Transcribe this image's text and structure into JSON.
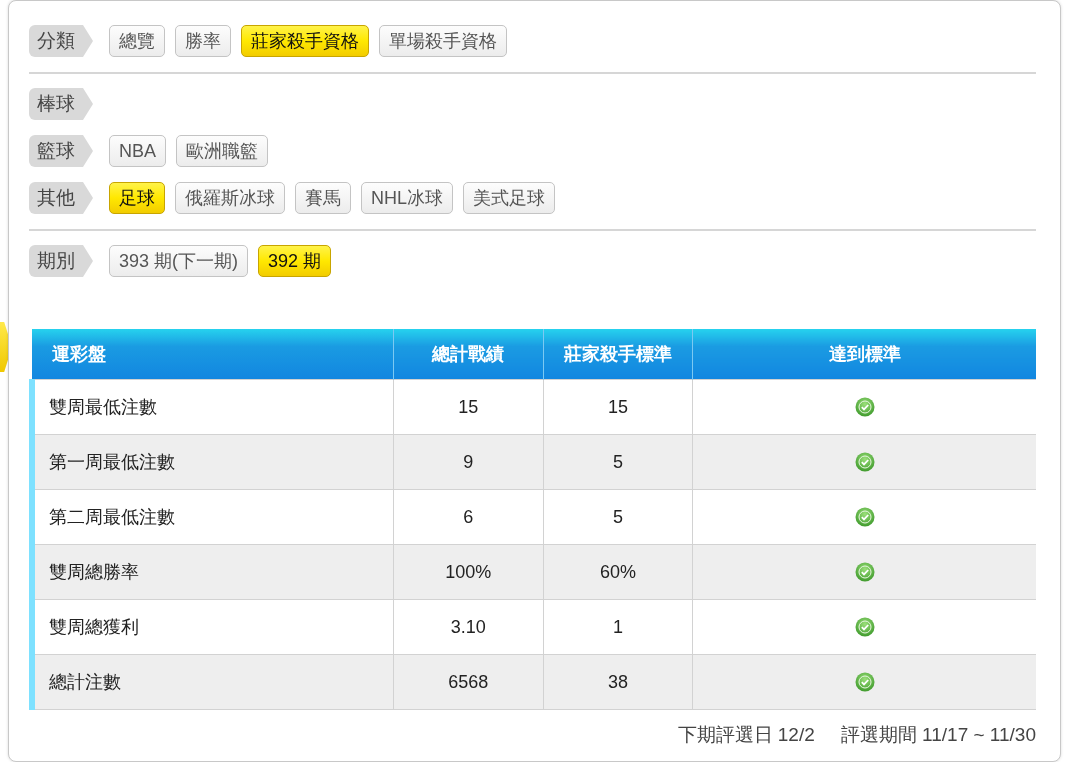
{
  "filter_groups": [
    {
      "label": "分類",
      "divider_after": true,
      "options": [
        {
          "label": "總覽",
          "selected": false
        },
        {
          "label": "勝率",
          "selected": false
        },
        {
          "label": "莊家殺手資格",
          "selected": true
        },
        {
          "label": "單場殺手資格",
          "selected": false
        }
      ]
    },
    {
      "label": "棒球",
      "divider_after": false
    },
    {
      "label": "籃球",
      "divider_after": false,
      "options": [
        {
          "label": "NBA",
          "selected": false
        },
        {
          "label": "歐洲職籃",
          "selected": false
        }
      ]
    },
    {
      "label": "其他",
      "divider_after": true,
      "options": [
        {
          "label": "足球",
          "selected": true
        },
        {
          "label": "俄羅斯冰球",
          "selected": false
        },
        {
          "label": "賽馬",
          "selected": false
        },
        {
          "label": "NHL冰球",
          "selected": false
        },
        {
          "label": "美式足球",
          "selected": false
        }
      ]
    },
    {
      "label": "期別",
      "divider_after": false,
      "options": [
        {
          "label": "393 期(下一期)",
          "selected": false
        },
        {
          "label": "392 期",
          "selected": true
        }
      ]
    }
  ],
  "table": {
    "columns": [
      "運彩盤",
      "總計戰績",
      "莊家殺手標準",
      "達到標準"
    ],
    "rows": [
      {
        "item": "雙周最低注數",
        "record": "15",
        "standard": "15",
        "met": true
      },
      {
        "item": "第一周最低注數",
        "record": "9",
        "standard": "5",
        "met": true
      },
      {
        "item": "第二周最低注數",
        "record": "6",
        "standard": "5",
        "met": true
      },
      {
        "item": "雙周總勝率",
        "record": "100%",
        "standard": "60%",
        "met": true
      },
      {
        "item": "雙周總獲利",
        "record": "3.10",
        "standard": "1",
        "met": true
      },
      {
        "item": "總計注數",
        "record": "6568",
        "standard": "38",
        "met": true
      }
    ]
  },
  "footer": [
    "下期評選日 12/2",
    "評選期間 11/17 ~ 11/30"
  ]
}
